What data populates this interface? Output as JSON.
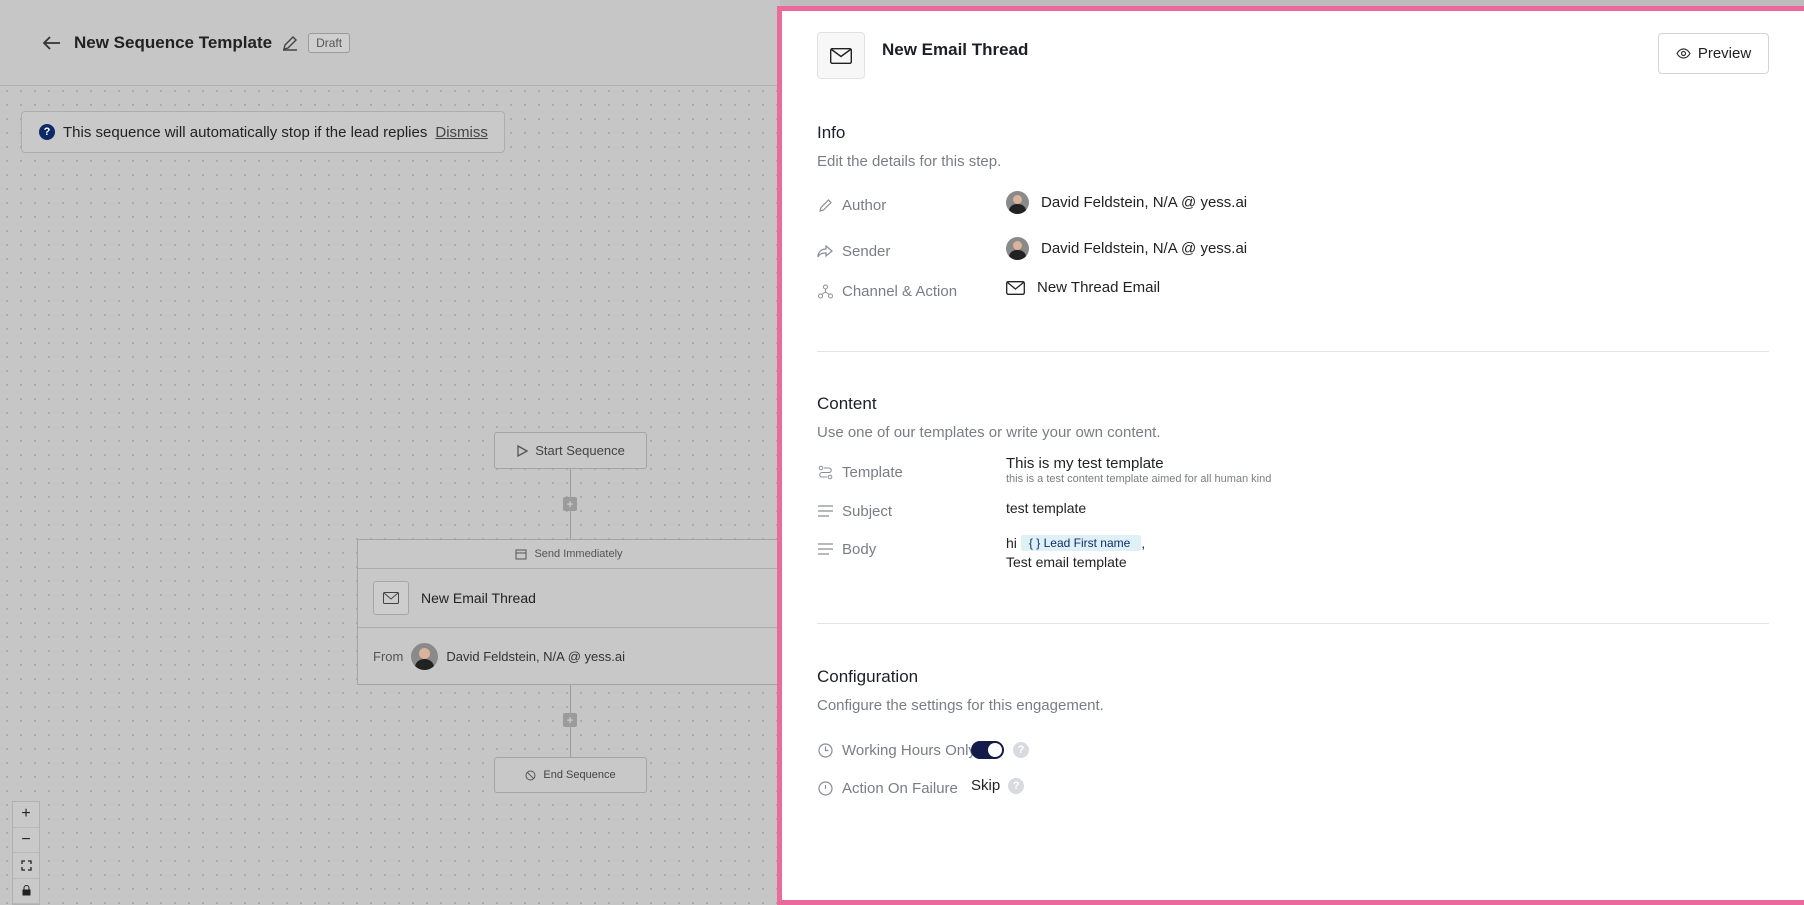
{
  "topbar": {
    "title": "New Sequence Template",
    "badge": "Draft"
  },
  "banner": {
    "text": "This sequence will automatically stop if the lead replies",
    "dismiss": "Dismiss"
  },
  "flow": {
    "start": "Start Sequence",
    "timing": "Send Immediately",
    "step_title": "New Email Thread",
    "from_label": "From",
    "from_value": "David Feldstein, N/A @ yess.ai",
    "end": "End Sequence"
  },
  "panel": {
    "title": "New Email Thread",
    "preview": "Preview",
    "info": {
      "heading": "Info",
      "sub": "Edit the details for this step.",
      "author_label": "Author",
      "author_value": "David Feldstein, N/A @ yess.ai",
      "sender_label": "Sender",
      "sender_value": "David Feldstein, N/A @ yess.ai",
      "channel_label": "Channel & Action",
      "channel_value": "New Thread Email"
    },
    "content": {
      "heading": "Content",
      "sub": "Use one of our templates or write your own content.",
      "template_label": "Template",
      "template_value": "This is my test template",
      "template_desc": "this is a test content template aimed for all human kind",
      "subject_label": "Subject",
      "subject_value": "test template",
      "body_label": "Body",
      "body_prefix": "hi",
      "body_tag": "{ } Lead First name",
      "body_suffix": ",",
      "body_line2": "Test email template"
    },
    "config": {
      "heading": "Configuration",
      "sub": "Configure the settings for this engagement.",
      "working_label": "Working Hours Only",
      "working_on": true,
      "failure_label": "Action On Failure",
      "failure_value": "Skip"
    }
  },
  "colors": {
    "accent": "#ec6a9b",
    "toggle": "#141a4a",
    "tag_bg": "#e0f0f7"
  }
}
